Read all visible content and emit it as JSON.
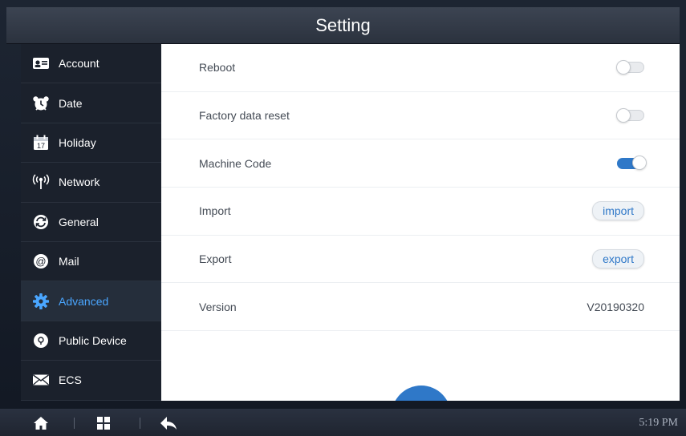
{
  "window": {
    "title": "Setting"
  },
  "sidebar": {
    "items": [
      {
        "label": "Account",
        "icon": "account-card-icon",
        "active": false
      },
      {
        "label": "Date",
        "icon": "alarm-clock-icon",
        "active": false
      },
      {
        "label": "Holiday",
        "icon": "calendar-icon",
        "active": false
      },
      {
        "label": "Network",
        "icon": "wifi-antenna-icon",
        "active": false
      },
      {
        "label": "General",
        "icon": "refresh-circle-icon",
        "active": false
      },
      {
        "label": "Mail",
        "icon": "at-sign-icon",
        "active": false
      },
      {
        "label": "Advanced",
        "icon": "gear-icon",
        "active": true
      },
      {
        "label": "Public Device",
        "icon": "device-circle-icon",
        "active": false
      },
      {
        "label": "ECS",
        "icon": "envelope-icon",
        "active": false
      }
    ]
  },
  "settings": {
    "rows": [
      {
        "label": "Reboot",
        "control": "toggle",
        "state": "off"
      },
      {
        "label": "Factory data reset",
        "control": "toggle",
        "state": "off"
      },
      {
        "label": "Machine Code",
        "control": "toggle",
        "state": "on"
      },
      {
        "label": "Import",
        "control": "button",
        "button_label": "import"
      },
      {
        "label": "Export",
        "control": "button",
        "button_label": "export"
      },
      {
        "label": "Version",
        "control": "value",
        "value": "V20190320"
      }
    ]
  },
  "taskbar": {
    "icons": [
      "home-icon",
      "grid-icon",
      "back-arrow-icon"
    ],
    "clock": "5:19 PM"
  },
  "colors": {
    "accent": "#2f78c8",
    "active_nav_text": "#4aa6ff",
    "sidebar_bg": "#1b212c",
    "content_bg": "#ffffff"
  }
}
